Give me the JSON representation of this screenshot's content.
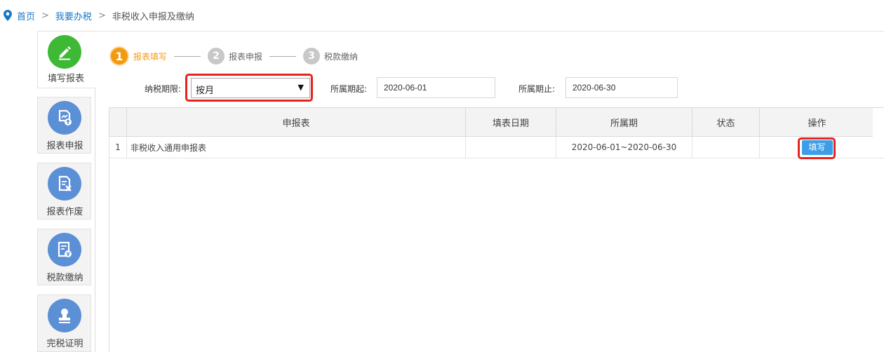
{
  "breadcrumb": {
    "home": "首页",
    "sep1": ">",
    "section": "我要办税",
    "sep2": ">",
    "current": "非税收入申报及缴纳"
  },
  "sidebar": [
    {
      "label": "填写报表",
      "icon": "edit-icon",
      "active": true
    },
    {
      "label": "报表申报",
      "icon": "report-upload-icon",
      "active": false
    },
    {
      "label": "报表作废",
      "icon": "report-void-icon",
      "active": false
    },
    {
      "label": "税款缴纳",
      "icon": "tax-payment-icon",
      "active": false
    },
    {
      "label": "完税证明",
      "icon": "stamp-icon",
      "active": false
    }
  ],
  "steps": [
    {
      "num": "1",
      "label": "报表填写",
      "active": true
    },
    {
      "num": "2",
      "label": "报表申报",
      "active": false
    },
    {
      "num": "3",
      "label": "税款缴纳",
      "active": false
    }
  ],
  "form": {
    "period_label": "纳税期限:",
    "period_value": "按月",
    "start_label": "所属期起:",
    "start_value": "2020-06-01",
    "end_label": "所属期止:",
    "end_value": "2020-06-30"
  },
  "table": {
    "headers": [
      "",
      "申报表",
      "填表日期",
      "所属期",
      "状态",
      "操作"
    ],
    "rows": [
      {
        "index": "1",
        "name": "非税收入通用申报表",
        "date": "",
        "period": "2020-06-01~2020-06-30",
        "status": "",
        "action": "填写"
      }
    ]
  },
  "colors": {
    "accent": "#3d9ee8",
    "step_active": "#f39a10",
    "highlight": "#e8231d",
    "side_active": "#3db935",
    "side_icon": "#5b8fd6"
  }
}
